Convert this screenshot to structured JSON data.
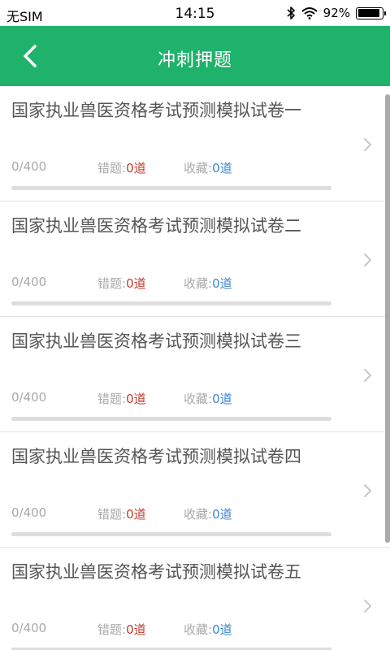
{
  "status_bar": {
    "carrier": "无SIM",
    "time": "14:15",
    "battery_percent": "92%",
    "battery_level": 0.92,
    "icons": [
      "bluetooth-icon",
      "wifi-icon",
      "battery-icon"
    ]
  },
  "header": {
    "title": "冲刺押题",
    "back_icon": "chevron-left-icon",
    "background_color": "#1fb26b"
  },
  "papers": [
    {
      "title": "国家执业兽医资格考试预测模拟试卷一",
      "progress": "0/400",
      "progress_fraction": 0,
      "wrong_label": "错题:",
      "wrong_count": "0道",
      "fav_label": "收藏:",
      "fav_count": "0道"
    },
    {
      "title": "国家执业兽医资格考试预测模拟试卷二",
      "progress": "0/400",
      "progress_fraction": 0,
      "wrong_label": "错题:",
      "wrong_count": "0道",
      "fav_label": "收藏:",
      "fav_count": "0道"
    },
    {
      "title": "国家执业兽医资格考试预测模拟试卷三",
      "progress": "0/400",
      "progress_fraction": 0,
      "wrong_label": "错题:",
      "wrong_count": "0道",
      "fav_label": "收藏:",
      "fav_count": "0道"
    },
    {
      "title": "国家执业兽医资格考试预测模拟试卷四",
      "progress": "0/400",
      "progress_fraction": 0,
      "wrong_label": "错题:",
      "wrong_count": "0道",
      "fav_label": "收藏:",
      "fav_count": "0道"
    },
    {
      "title": "国家执业兽医资格考试预测模拟试卷五",
      "progress": "0/400",
      "progress_fraction": 0,
      "wrong_label": "错题:",
      "wrong_count": "0道",
      "fav_label": "收藏:",
      "fav_count": "0道"
    }
  ],
  "colors": {
    "accent": "#1fb26b",
    "wrong": "#c0392b",
    "favorite": "#3b84d6"
  }
}
